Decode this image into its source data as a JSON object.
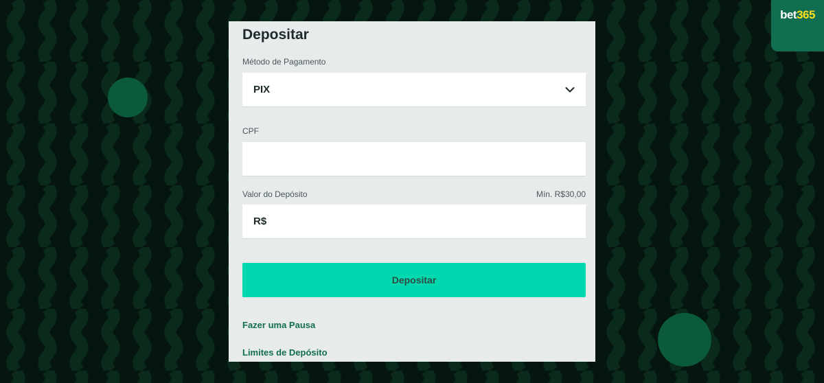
{
  "brand": {
    "logo_part1": "bet",
    "logo_part2": "365"
  },
  "form": {
    "title": "Depositar",
    "payment_method": {
      "label": "Método de Pagamento",
      "selected": "PIX"
    },
    "cpf": {
      "label": "CPF",
      "value": ""
    },
    "amount": {
      "label": "Valor do Depósito",
      "minimum": "Mín. R$30,00",
      "currency": "R$",
      "value": ""
    },
    "submit_label": "Depositar",
    "links": {
      "pause": "Fazer uma Pausa",
      "limits": "Limites de Depósito"
    }
  },
  "icons": {
    "dropdown": "chevron-down-icon"
  },
  "colors": {
    "background": "#051510",
    "wave": "#0a2a1c",
    "brand_green": "#126e51",
    "brand_yellow": "#ffdf1b",
    "accent": "#00d9b0",
    "panel": "#e7ebec"
  }
}
